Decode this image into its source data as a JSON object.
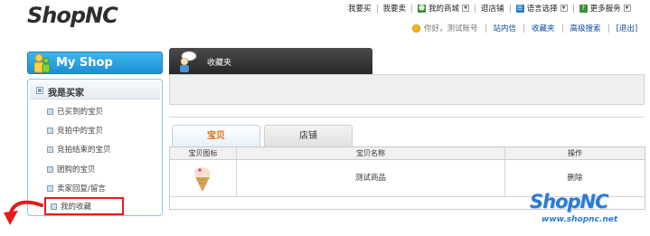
{
  "header": {
    "logo_part1": "Shop",
    "logo_part2": "NC",
    "topnav": [
      {
        "label": "我要买"
      },
      {
        "label": "我要卖"
      },
      {
        "label": "我的商城",
        "icon": "user-icon"
      },
      {
        "label": "逛店铺"
      },
      {
        "label": "语言选择",
        "icon": "language-icon"
      },
      {
        "label": "更多服务",
        "icon": "help-icon"
      }
    ],
    "greeting": "你好，测试账号",
    "user_links": [
      "站内信",
      "收藏夹",
      "高级搜索",
      "[退出]"
    ]
  },
  "sidebar": {
    "myshop_label": "My Shop",
    "section_title": "我是买家",
    "items": [
      {
        "label": "已买到的宝贝"
      },
      {
        "label": "竞拍中的宝贝"
      },
      {
        "label": "竞拍结束的宝贝"
      },
      {
        "label": "团购的宝贝"
      },
      {
        "label": "卖家回复/留言"
      },
      {
        "label": "我的收藏",
        "active": true
      }
    ]
  },
  "main": {
    "tab_title": "收藏夹",
    "tabs": [
      {
        "label": "宝贝",
        "active": true
      },
      {
        "label": "店铺",
        "active": false
      }
    ],
    "table": {
      "columns": [
        "宝贝图标",
        "宝贝名称",
        "操作"
      ],
      "rows": [
        {
          "name": "测试商品",
          "action": "删除"
        }
      ]
    }
  },
  "watermark": {
    "brand": "ShopNC",
    "url": "www.shopnc.net"
  },
  "colors": {
    "accent_blue": "#1c8fd4",
    "highlight_red": "#e31c1c",
    "active_tab_text": "#e06c00",
    "link_blue": "#0a4a9c"
  }
}
